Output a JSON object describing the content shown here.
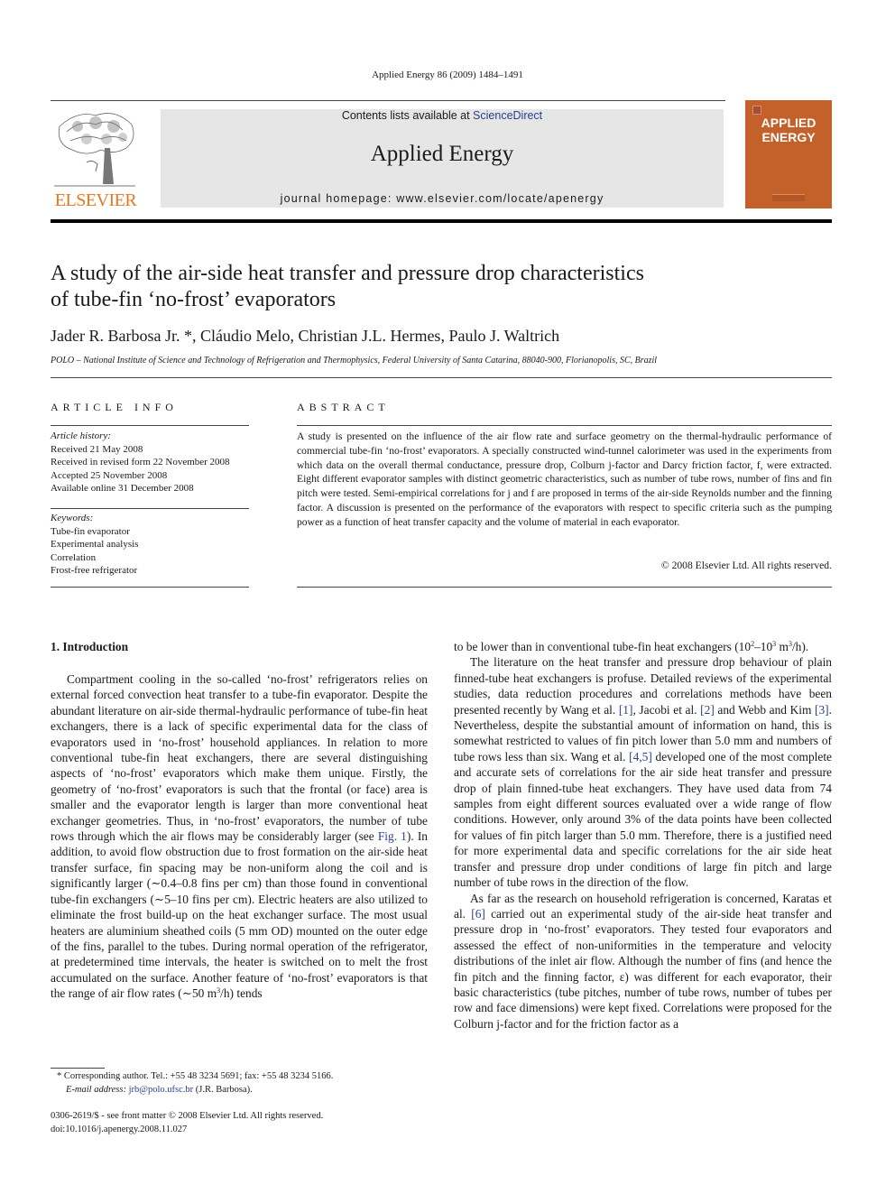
{
  "header": {
    "citation": "Applied Energy 86 (2009) 1484–1491",
    "contents_prefix": "Contents lists available at ",
    "contents_link": "ScienceDirect",
    "journal_title": "Applied Energy",
    "homepage": "journal homepage: www.elsevier.com/locate/apenergy",
    "publisher_logo_text": "ELSEVIER",
    "cover_title_line1": "APPLIED",
    "cover_title_line2": "ENERGY",
    "colors": {
      "banner_bg": "#e6e6e6",
      "cover": "#c4602a",
      "elsevier_orange": "#e87722",
      "link": "#2a3f8f"
    }
  },
  "article": {
    "title_line1": "A study of the air-side heat transfer and pressure drop characteristics",
    "title_line2": "of tube-fin ‘no-frost’ evaporators",
    "authors": "Jader R. Barbosa Jr. *, Cláudio Melo, Christian J.L. Hermes, Paulo J. Waltrich",
    "affiliation": "POLO – National Institute of Science and Technology of Refrigeration and Thermophysics, Federal University of Santa Catarina, 88040-900, Florianopolis, SC, Brazil"
  },
  "article_info": {
    "heading": "ARTICLE INFO",
    "history_label": "Article history:",
    "history": [
      "Received 21 May 2008",
      "Received in revised form 22 November 2008",
      "Accepted 25 November 2008",
      "Available online 31 December 2008"
    ],
    "keywords_label": "Keywords:",
    "keywords": [
      "Tube-fin evaporator",
      "Experimental analysis",
      "Correlation",
      "Frost-free refrigerator"
    ]
  },
  "abstract": {
    "heading": "ABSTRACT",
    "text": "A study is presented on the influence of the air flow rate and surface geometry on the thermal-hydraulic performance of commercial tube-fin ‘no-frost’ evaporators. A specially constructed wind-tunnel calorimeter was used in the experiments from which data on the overall thermal conductance, pressure drop, Colburn j-factor and Darcy friction factor, f, were extracted. Eight different evaporator samples with distinct geometric characteristics, such as number of tube rows, number of fins and fin pitch were tested. Semi-empirical correlations for j and f are proposed in terms of the air-side Reynolds number and the finning factor. A discussion is presented on the performance of the evaporators with respect to specific criteria such as the pumping power as a function of heat transfer capacity and the volume of material in each evaporator.",
    "copyright": "© 2008 Elsevier Ltd. All rights reserved."
  },
  "body": {
    "section_heading": "1. Introduction",
    "col1_p1_a": "Compartment cooling in the so-called ‘no-frost’ refrigerators relies on external forced convection heat transfer to a tube-fin evaporator. Despite the abundant literature on air-side thermal-hydraulic performance of tube-fin heat exchangers, there is a lack of specific experimental data for the class of evaporators used in ‘no-frost’ household appliances. In relation to more conventional tube-fin heat exchangers, there are several distinguishing aspects of ‘no-frost’ evaporators which make them unique. Firstly, the geometry of ‘no-frost’ evaporators is such that the frontal (or face) area is smaller and the evaporator length is larger than more conventional heat exchanger geometries. Thus, in ‘no-frost’ evaporators, the number of tube rows through which the air flows may be considerably larger (see ",
    "col1_fig_ref": "Fig. 1",
    "col1_p1_b": "). In addition, to avoid flow obstruction due to frost formation on the air-side heat transfer surface, fin spacing may be non-uniform along the coil and is significantly larger (∼0.4–0.8 fins per cm) than those found in conventional tube-fin exchangers (∼5–10 fins per cm). Electric heaters are also utilized to eliminate the frost build-up on the heat exchanger surface. The most usual heaters are aluminium sheathed coils (5 mm OD) mounted on the outer edge of the fins, parallel to the tubes. During normal operation of the refrigerator, at predetermined time intervals, the heater is switched on to melt the frost accumulated on the surface. Another feature of ‘no-frost’ evaporators is that the range of air flow rates (∼50 m",
    "col1_sup": "3",
    "col1_p1_c": "/h) tends",
    "col2_p1_a": "to be lower than in conventional tube-fin heat exchangers (10",
    "col2_sup1": "2",
    "col2_p1_b": "–10",
    "col2_sup2": "3",
    "col2_p1_c": " m",
    "col2_sup3": "3",
    "col2_p1_d": "/h).",
    "col2_p2_a": "The literature on the heat transfer and pressure drop behaviour of plain finned-tube heat exchangers is profuse. Detailed reviews of the experimental studies, data reduction procedures and correlations methods have been presented recently by Wang et al. ",
    "ref1": "[1]",
    "col2_p2_b": ", Jacobi et al. ",
    "ref2": "[2]",
    "col2_p2_c": " and Webb and Kim ",
    "ref3": "[3]",
    "col2_p2_d": ". Nevertheless, despite the substantial amount of information on hand, this is somewhat restricted to values of fin pitch lower than 5.0 mm and numbers of tube rows less than six. Wang et al. ",
    "ref45": "[4,5]",
    "col2_p2_e": " developed one of the most complete and accurate sets of correlations for the air side heat transfer and pressure drop of plain finned-tube heat exchangers. They have used data from 74 samples from eight different sources evaluated over a wide range of flow conditions. However, only around 3% of the data points have been collected for values of fin pitch larger than 5.0 mm. Therefore, there is a justified need for more experimental data and specific correlations for the air side heat transfer and pressure drop under conditions of large fin pitch and large number of tube rows in the direction of the flow.",
    "col2_p3_a": "As far as the research on household refrigeration is concerned, Karatas et al. ",
    "ref6": "[6]",
    "col2_p3_b": " carried out an experimental study of the air-side heat transfer and pressure drop in ‘no-frost’ evaporators. They tested four evaporators and assessed the effect of non-uniformities in the temperature and velocity distributions of the inlet air flow. Although the number of fins (and hence the fin pitch and the finning factor, ε) was different for each evaporator, their basic characteristics (tube pitches, number of tube rows, number of tubes per row and face dimensions) were kept fixed. Correlations were proposed for the Colburn j-factor and for the friction factor as a"
  },
  "footnote": {
    "line1": "* Corresponding author. Tel.: +55 48 3234 5691; fax: +55 48 3234 5166.",
    "email_label": "E-mail address: ",
    "email": "jrb@polo.ufsc.br",
    "email_suffix": " (J.R. Barbosa)."
  },
  "front_matter": {
    "issn": "0306-2619/$ - see front matter © 2008 Elsevier Ltd. All rights reserved.",
    "doi": "doi:10.1016/j.apenergy.2008.11.027"
  }
}
